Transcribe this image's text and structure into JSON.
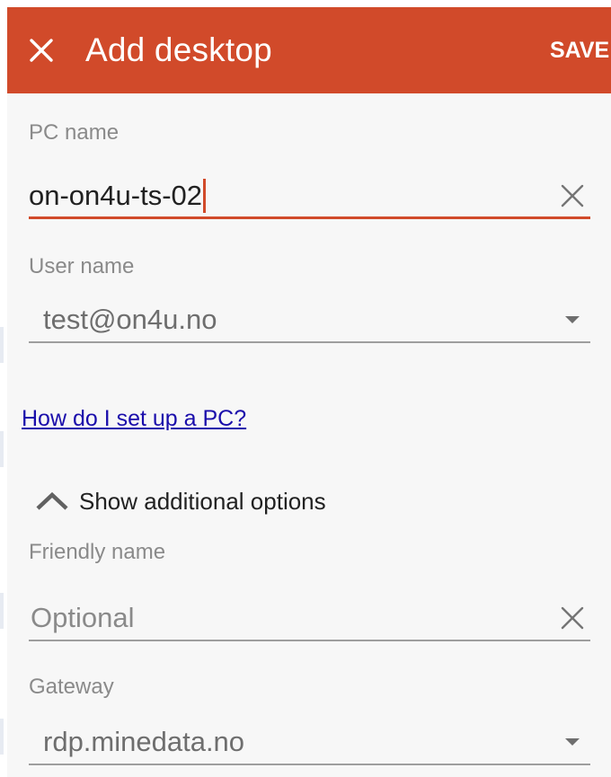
{
  "appbar": {
    "title": "Add desktop",
    "save_label": "SAVE",
    "close_icon": "close-icon",
    "color": "#d14a2a"
  },
  "pc_name": {
    "label": "PC name",
    "value": "on-on4u-ts-02",
    "trailing_icon": "clear-icon"
  },
  "user_name": {
    "label": "User name",
    "value": "test@on4u.no",
    "trailing_icon": "dropdown-arrow-icon"
  },
  "help_link": {
    "text": "How do I set up a PC?"
  },
  "additional_options": {
    "label": "Show additional options",
    "icon": "chevron-up-icon"
  },
  "friendly_name": {
    "label": "Friendly name",
    "placeholder": "Optional",
    "trailing_icon": "clear-icon"
  },
  "gateway": {
    "label": "Gateway",
    "value": "rdp.minedata.no",
    "trailing_icon": "dropdown-arrow-icon"
  },
  "colors": {
    "accent": "#d14a2a",
    "link": "#1a0dab",
    "background": "#f7f7f7"
  }
}
